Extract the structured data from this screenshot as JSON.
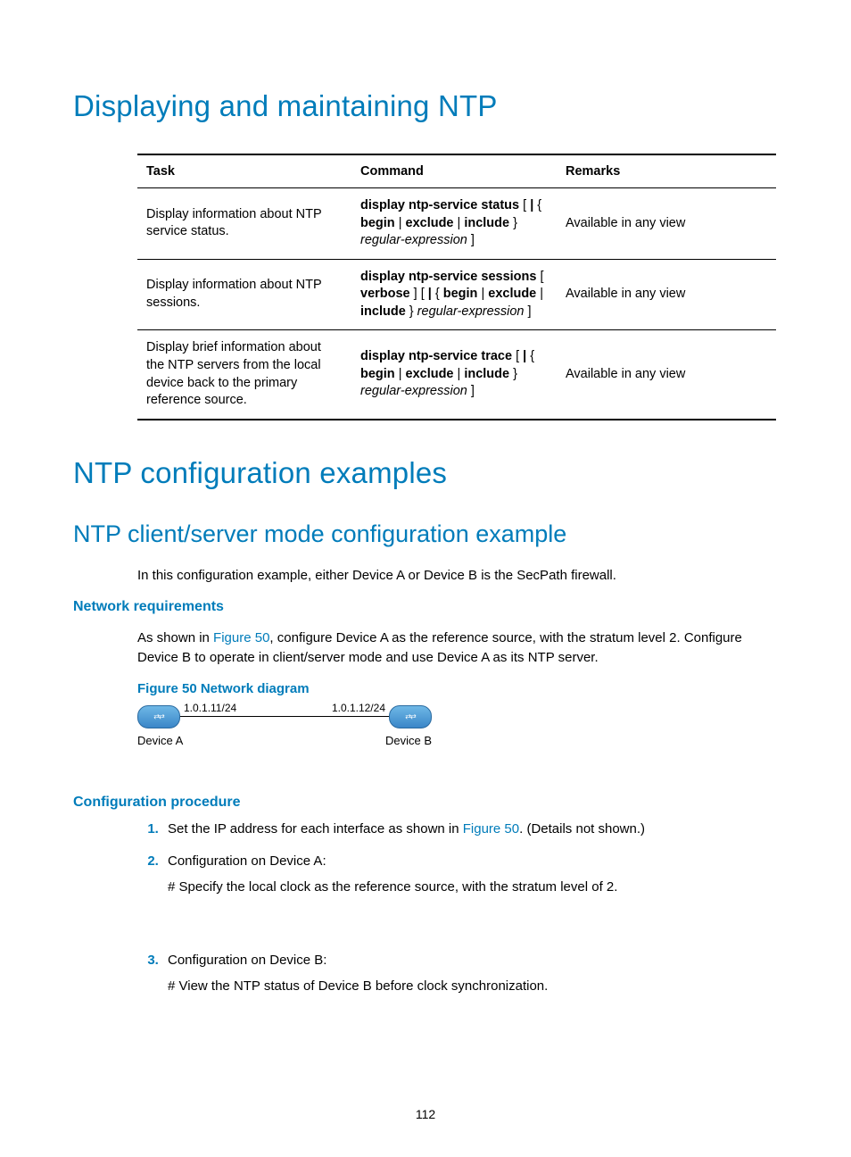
{
  "headings": {
    "h1a": "Displaying and maintaining NTP",
    "h1b": "NTP configuration examples",
    "h2a": "NTP client/server mode configuration example",
    "h3a": "Network requirements",
    "h3b": "Configuration procedure"
  },
  "table": {
    "headers": {
      "task": "Task",
      "command": "Command",
      "remarks": "Remarks"
    },
    "rows": [
      {
        "task": "Display information about NTP service status.",
        "command_html": "<b>display ntp-service status</b> [ <b>|</b> { <b>begin</b> | <b>exclude</b> | <b>include</b> } <i>regular-expression</i> ]",
        "remarks": "Available in any view"
      },
      {
        "task": "Display information about NTP sessions.",
        "command_html": "<b>display ntp-service sessions</b> [ <b>verbose</b> ] [ <b>|</b> { <b>begin</b> | <b>exclude</b> | <b>include</b> } <i>regular-expression</i> ]",
        "remarks": "Available in any view"
      },
      {
        "task": "Display brief information about the NTP servers from the local device back to the primary reference source.",
        "command_html": "<b>display ntp-service trace</b> [ <b>|</b> { <b>begin</b> | <b>exclude</b> | <b>include</b> } <i>regular-expression</i> ]",
        "remarks": "Available in any view"
      }
    ]
  },
  "intro_p": "In this configuration example, either Device A or Device B is the SecPath firewall.",
  "netreq": {
    "prefix": "As shown in ",
    "link": "Figure 50",
    "rest": ", configure Device A as the reference source, with the stratum level 2. Configure Device B to operate in client/server mode and use Device A as its NTP server."
  },
  "figcap": "Figure 50 Network diagram",
  "diagram": {
    "ip_a": "1.0.1.11/24",
    "ip_b": "1.0.1.12/24",
    "dev_a": "Device A",
    "dev_b": "Device B"
  },
  "steps": [
    {
      "text_prefix": "Set the IP address for each interface as shown in ",
      "link": "Figure 50",
      "text_suffix": ". (Details not shown.)"
    },
    {
      "text": "Configuration on Device A:",
      "sub": "# Specify the local clock as the reference source, with the stratum level of 2."
    },
    {
      "text": "Configuration on Device B:",
      "sub": "# View the NTP status of Device B before clock synchronization."
    }
  ],
  "pagenum": "112"
}
